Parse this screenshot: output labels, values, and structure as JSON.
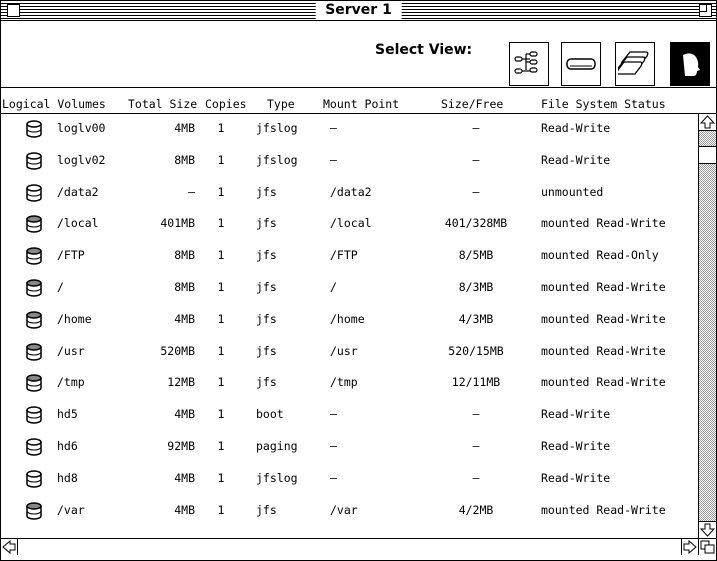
{
  "window": {
    "title": "Server 1"
  },
  "view_selector": {
    "label": "Select View:",
    "buttons": [
      {
        "name": "tree-view",
        "icon": "tree-icon",
        "active": false
      },
      {
        "name": "disk-view",
        "icon": "disk-icon",
        "active": false
      },
      {
        "name": "stack-view",
        "icon": "stacked-disks-icon",
        "active": false
      },
      {
        "name": "head-view",
        "icon": "profile-head-icon",
        "active": true
      }
    ]
  },
  "columns": [
    "Logical Volumes",
    "Total Size",
    "Copies",
    "Type",
    "Mount Point",
    "Size/Free",
    "File System Status"
  ],
  "volumes": [
    {
      "icon": "empty-cylinder-icon",
      "name": "loglv00",
      "total": "4MB",
      "copies": "1",
      "type": "jfslog",
      "mount": "–",
      "sizefree": "–",
      "status": "Read-Write"
    },
    {
      "icon": "empty-cylinder-icon",
      "name": "loglv02",
      "total": "8MB",
      "copies": "1",
      "type": "jfslog",
      "mount": "–",
      "sizefree": "–",
      "status": "Read-Write"
    },
    {
      "icon": "empty-cylinder-icon",
      "name": "/data2",
      "total": "–",
      "copies": "1",
      "type": "jfs",
      "mount": "/data2",
      "sizefree": "–",
      "status": "unmounted"
    },
    {
      "icon": "filled-cylinder-icon",
      "name": "/local",
      "total": "401MB",
      "copies": "1",
      "type": "jfs",
      "mount": "/local",
      "sizefree": "401/328MB",
      "status": "mounted Read-Write"
    },
    {
      "icon": "filled-cylinder-icon",
      "name": "/FTP",
      "total": "8MB",
      "copies": "1",
      "type": "jfs",
      "mount": "/FTP",
      "sizefree": "8/5MB",
      "status": "mounted Read-Only"
    },
    {
      "icon": "filled-cylinder-icon",
      "name": "/",
      "total": "8MB",
      "copies": "1",
      "type": "jfs",
      "mount": "/",
      "sizefree": "8/3MB",
      "status": "mounted Read-Write"
    },
    {
      "icon": "filled-cylinder-icon",
      "name": "/home",
      "total": "4MB",
      "copies": "1",
      "type": "jfs",
      "mount": "/home",
      "sizefree": "4/3MB",
      "status": "mounted Read-Write"
    },
    {
      "icon": "filled-cylinder-icon",
      "name": "/usr",
      "total": "520MB",
      "copies": "1",
      "type": "jfs",
      "mount": "/usr",
      "sizefree": "520/15MB",
      "status": "mounted Read-Write"
    },
    {
      "icon": "filled-cylinder-icon",
      "name": "/tmp",
      "total": "12MB",
      "copies": "1",
      "type": "jfs",
      "mount": "/tmp",
      "sizefree": "12/11MB",
      "status": "mounted Read-Write"
    },
    {
      "icon": "empty-cylinder-icon",
      "name": "hd5",
      "total": "4MB",
      "copies": "1",
      "type": "boot",
      "mount": "–",
      "sizefree": "–",
      "status": "Read-Write"
    },
    {
      "icon": "empty-cylinder-icon",
      "name": "hd6",
      "total": "92MB",
      "copies": "1",
      "type": "paging",
      "mount": "–",
      "sizefree": "–",
      "status": "Read-Write"
    },
    {
      "icon": "empty-cylinder-icon",
      "name": "hd8",
      "total": "4MB",
      "copies": "1",
      "type": "jfslog",
      "mount": "–",
      "sizefree": "–",
      "status": "Read-Write"
    },
    {
      "icon": "filled-cylinder-icon",
      "name": "/var",
      "total": "4MB",
      "copies": "1",
      "type": "jfs",
      "mount": "/var",
      "sizefree": "4/2MB",
      "status": "mounted Read-Write"
    }
  ]
}
